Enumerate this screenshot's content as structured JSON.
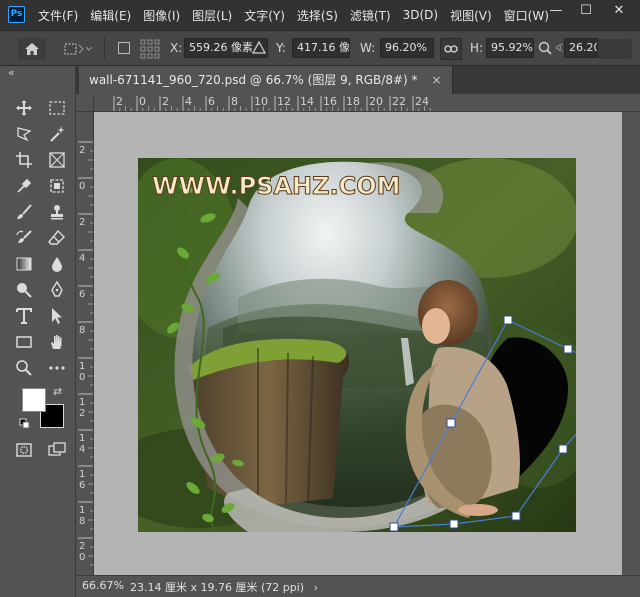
{
  "app": {
    "logo_text": "Ps"
  },
  "menu": [
    "文件(F)",
    "编辑(E)",
    "图像(I)",
    "图层(L)",
    "文字(Y)",
    "选择(S)",
    "滤镜(T)",
    "3D(D)",
    "视图(V)",
    "窗口(W)"
  ],
  "window_controls": {
    "minimize": "—",
    "maximize": "☐",
    "close": "✕"
  },
  "options_bar": {
    "x_label": "X:",
    "x_value": "559.26 像素",
    "y_label": "Y:",
    "y_value": "417.16 像素",
    "w_label": "W:",
    "w_value": "96.20%",
    "h_label": "H:",
    "h_value": "95.92%",
    "angle_value": "26.20"
  },
  "toolbar": {
    "collapse_label": "«"
  },
  "document_tab": {
    "title": "wall-671141_960_720.psd @ 66.7% (图层 9, RGB/8#) *",
    "close_label": "×"
  },
  "ruler_top_labels": [
    "2",
    "0",
    "2",
    "4",
    "6",
    "8",
    "10",
    "12",
    "14",
    "16",
    "18",
    "20",
    "22",
    "24"
  ],
  "ruler_left_labels": [
    "2",
    "0",
    "2",
    "4",
    "6",
    "8",
    "1\n0",
    "1\n2",
    "1\n4",
    "1\n6",
    "1\n8",
    "2\n0"
  ],
  "canvas": {
    "watermark": "WWW.PSAHZ.COM"
  },
  "status_bar": {
    "zoom": "66.67%",
    "doc_size": "23.14 厘米 x 19.76 厘米 (72 ppi)",
    "arrow": "›"
  },
  "colors": {
    "foreground": "#ffffff",
    "background": "#000000",
    "accent": "#31a8ff",
    "transform_lines": "#4a7bd6"
  }
}
